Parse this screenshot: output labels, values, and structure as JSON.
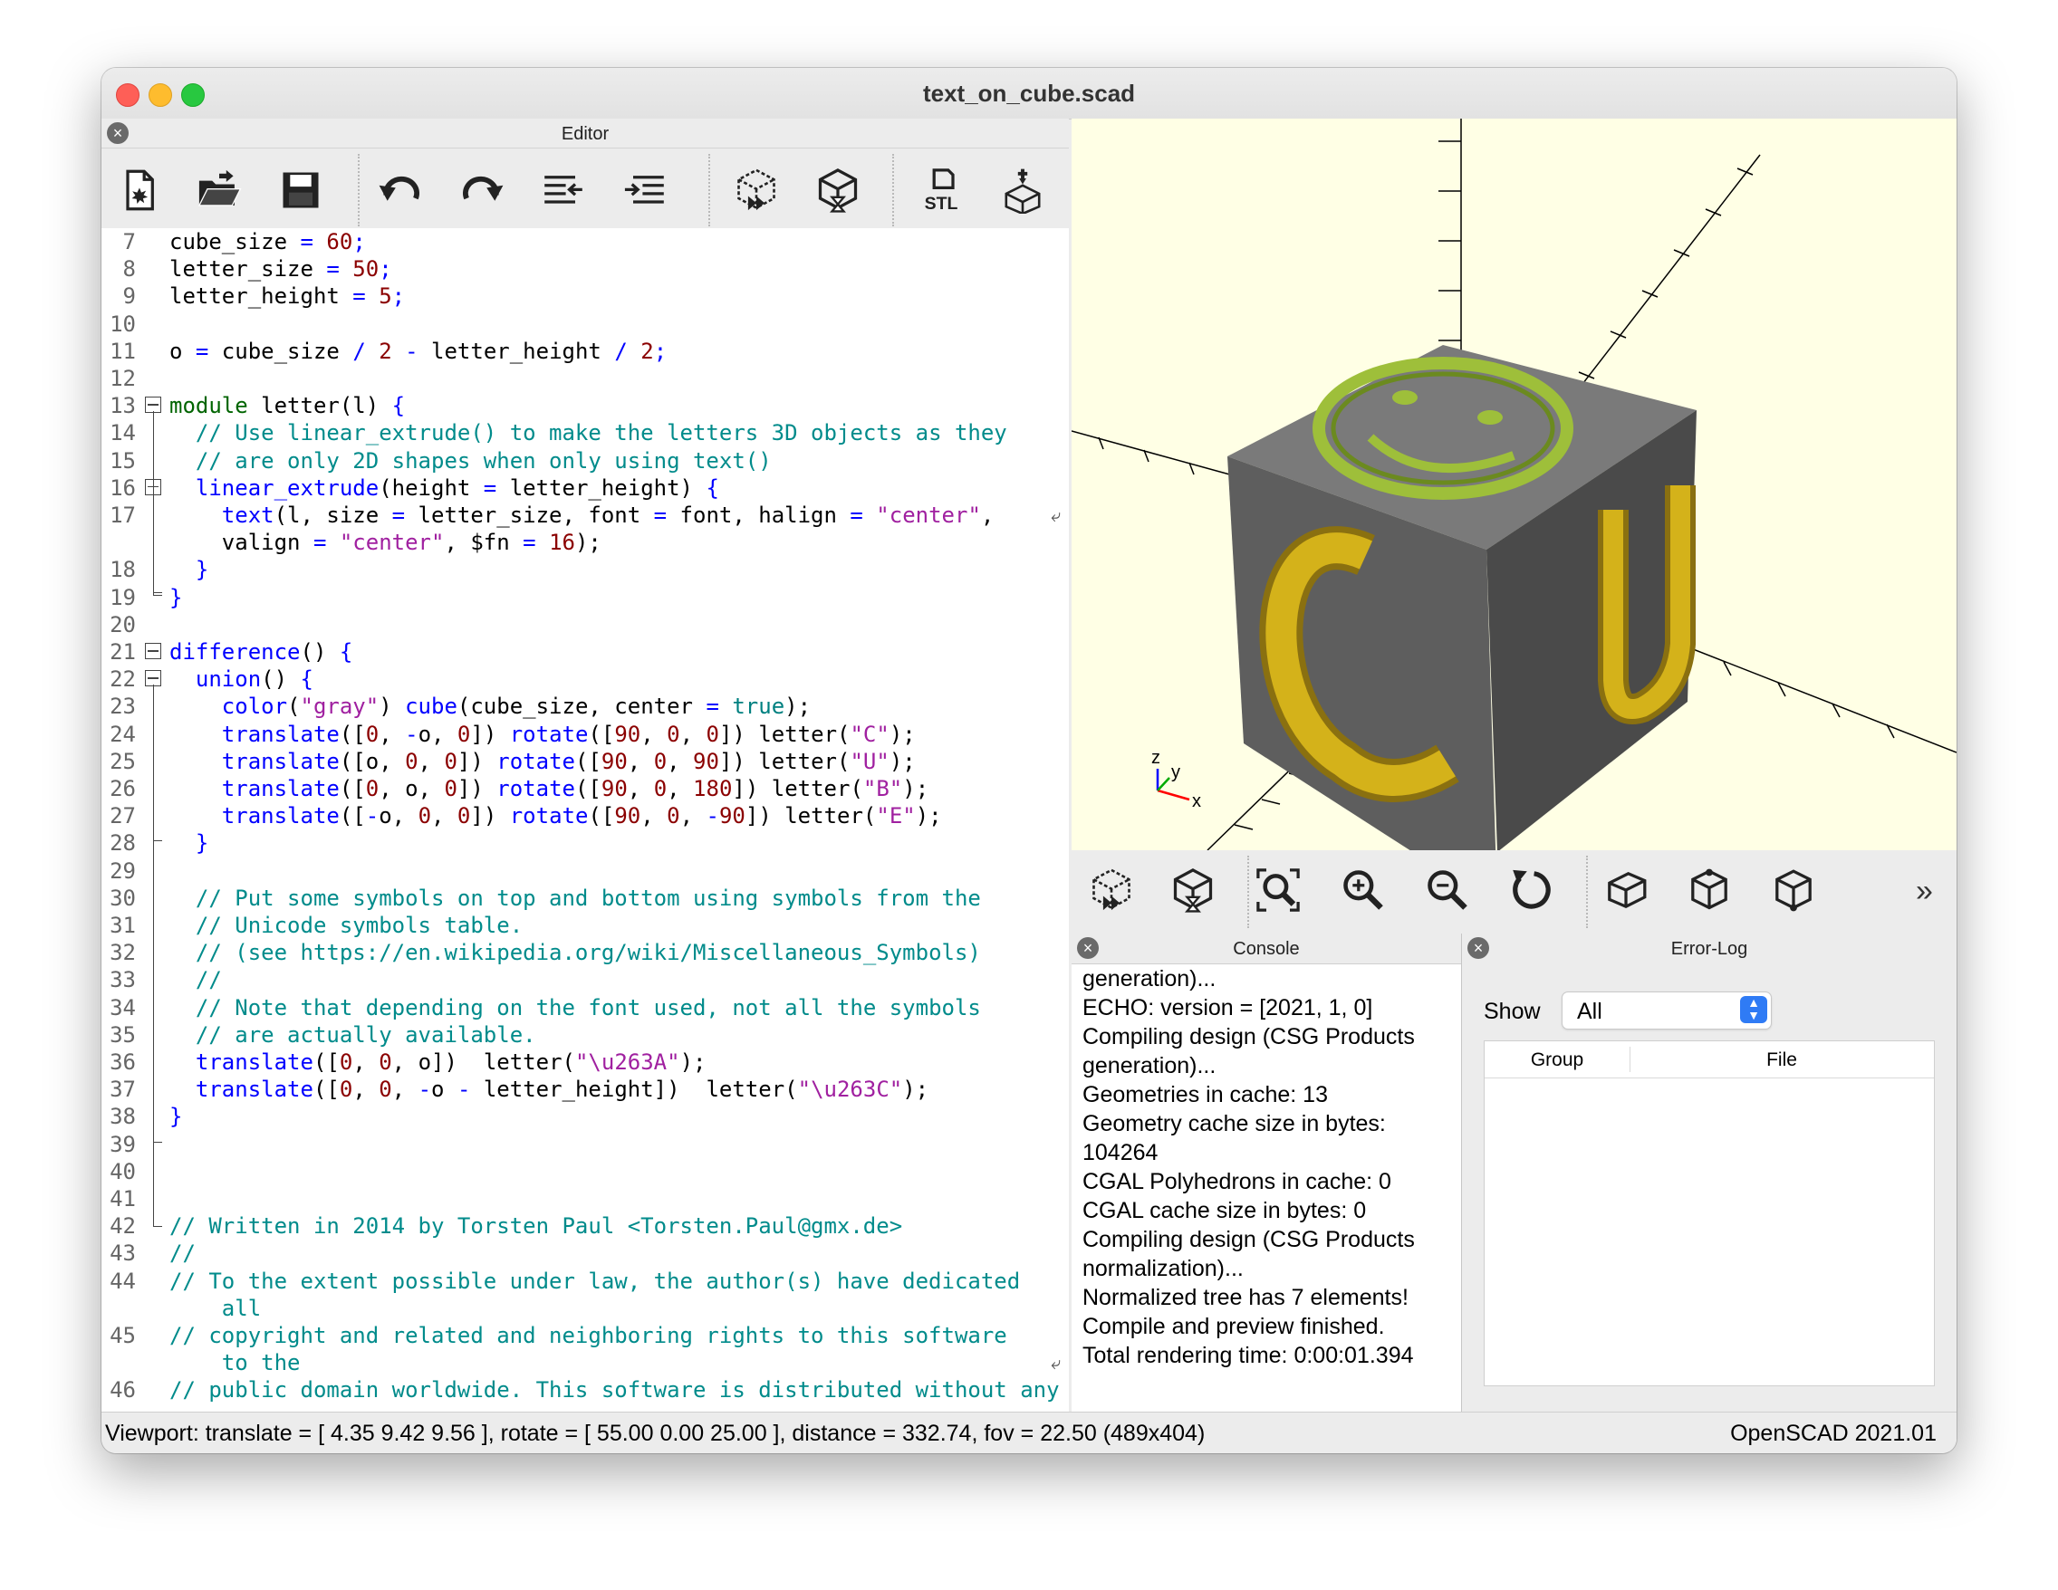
{
  "window": {
    "title": "text_on_cube.scad"
  },
  "editor": {
    "title": "Editor",
    "toolbar": [
      "new-file",
      "open-file",
      "save-file",
      "undo",
      "redo",
      "unindent",
      "indent",
      "preview",
      "render",
      "export-stl",
      "send-to-3d-print"
    ],
    "toolbar_stl_label": "STL",
    "lines": [
      {
        "n": "7",
        "t": [
          [
            "",
            "cube_size "
          ],
          [
            "o",
            "="
          ],
          [
            "",
            " "
          ],
          [
            "n",
            "60"
          ],
          [
            "o",
            ";"
          ]
        ]
      },
      {
        "n": "8",
        "t": [
          [
            "",
            "letter_size "
          ],
          [
            "o",
            "="
          ],
          [
            "",
            " "
          ],
          [
            "n",
            "50"
          ],
          [
            "o",
            ";"
          ]
        ]
      },
      {
        "n": "9",
        "t": [
          [
            "",
            "letter_height "
          ],
          [
            "o",
            "="
          ],
          [
            "",
            " "
          ],
          [
            "n",
            "5"
          ],
          [
            "o",
            ";"
          ]
        ]
      },
      {
        "n": "10",
        "t": []
      },
      {
        "n": "11",
        "t": [
          [
            "",
            "o "
          ],
          [
            "o",
            "="
          ],
          [
            "",
            " cube_size "
          ],
          [
            "o",
            "/"
          ],
          [
            "",
            " "
          ],
          [
            "n",
            "2"
          ],
          [
            "",
            " "
          ],
          [
            "o",
            "-"
          ],
          [
            "",
            " letter_height "
          ],
          [
            "o",
            "/"
          ],
          [
            "",
            " "
          ],
          [
            "n",
            "2"
          ],
          [
            "o",
            ";"
          ]
        ]
      },
      {
        "n": "12",
        "t": []
      },
      {
        "n": "13",
        "t": [
          [
            "m",
            "module"
          ],
          [
            "",
            " letter(l) "
          ],
          [
            "o",
            "{"
          ]
        ]
      },
      {
        "n": "14",
        "t": [
          [
            "",
            "  "
          ],
          [
            "c",
            "// Use linear_extrude() to make the letters 3D objects as they"
          ]
        ]
      },
      {
        "n": "15",
        "t": [
          [
            "",
            "  "
          ],
          [
            "c",
            "// are only 2D shapes when only using text()"
          ]
        ]
      },
      {
        "n": "16",
        "t": [
          [
            "",
            "  "
          ],
          [
            "k",
            "linear_extrude"
          ],
          [
            "",
            "(height "
          ],
          [
            "o",
            "="
          ],
          [
            "",
            " letter_height) "
          ],
          [
            "o",
            "{"
          ]
        ]
      },
      {
        "n": "17",
        "t": [
          [
            "",
            "    "
          ],
          [
            "k",
            "text"
          ],
          [
            "",
            "(l, size "
          ],
          [
            "o",
            "="
          ],
          [
            "",
            " letter_size, font "
          ],
          [
            "o",
            "="
          ],
          [
            "",
            " font, halign "
          ],
          [
            "o",
            "="
          ],
          [
            "",
            " "
          ],
          [
            "s",
            "\"center\""
          ],
          [
            "",
            ","
          ]
        ]
      },
      {
        "n": "",
        "t": [
          [
            "",
            "    valign "
          ],
          [
            "o",
            "="
          ],
          [
            "",
            " "
          ],
          [
            "s",
            "\"center\""
          ],
          [
            "",
            ", $fn "
          ],
          [
            "o",
            "="
          ],
          [
            "",
            " "
          ],
          [
            "n",
            "16"
          ],
          [
            "",
            ");"
          ]
        ]
      },
      {
        "n": "18",
        "t": [
          [
            "",
            "  "
          ],
          [
            "o",
            "}"
          ]
        ]
      },
      {
        "n": "19",
        "t": [
          [
            "o",
            "}"
          ]
        ]
      },
      {
        "n": "20",
        "t": []
      },
      {
        "n": "21",
        "t": [
          [
            "k",
            "difference"
          ],
          [
            "",
            "() "
          ],
          [
            "o",
            "{"
          ]
        ]
      },
      {
        "n": "22",
        "t": [
          [
            "",
            "  "
          ],
          [
            "k",
            "union"
          ],
          [
            "",
            "() "
          ],
          [
            "o",
            "{"
          ]
        ]
      },
      {
        "n": "23",
        "t": [
          [
            "",
            "    "
          ],
          [
            "k",
            "color"
          ],
          [
            "",
            "("
          ],
          [
            "s",
            "\"gray\""
          ],
          [
            "",
            ") "
          ],
          [
            "k",
            "cube"
          ],
          [
            "",
            "(cube_size, center "
          ],
          [
            "o",
            "="
          ],
          [
            "",
            " "
          ],
          [
            "b",
            "true"
          ],
          [
            "",
            ");"
          ]
        ]
      },
      {
        "n": "24",
        "t": [
          [
            "",
            "    "
          ],
          [
            "k",
            "translate"
          ],
          [
            "",
            "(["
          ],
          [
            "n",
            "0"
          ],
          [
            "",
            ", "
          ],
          [
            "o",
            "-"
          ],
          [
            "",
            "o, "
          ],
          [
            "n",
            "0"
          ],
          [
            "",
            "]) "
          ],
          [
            "k",
            "rotate"
          ],
          [
            "",
            "(["
          ],
          [
            "n",
            "90"
          ],
          [
            "",
            ", "
          ],
          [
            "n",
            "0"
          ],
          [
            "",
            ", "
          ],
          [
            "n",
            "0"
          ],
          [
            "",
            "]) letter("
          ],
          [
            "s",
            "\"C\""
          ],
          [
            "",
            ");"
          ]
        ]
      },
      {
        "n": "25",
        "t": [
          [
            "",
            "    "
          ],
          [
            "k",
            "translate"
          ],
          [
            "",
            "([o, "
          ],
          [
            "n",
            "0"
          ],
          [
            "",
            ", "
          ],
          [
            "n",
            "0"
          ],
          [
            "",
            "]) "
          ],
          [
            "k",
            "rotate"
          ],
          [
            "",
            "(["
          ],
          [
            "n",
            "90"
          ],
          [
            "",
            ", "
          ],
          [
            "n",
            "0"
          ],
          [
            "",
            ", "
          ],
          [
            "n",
            "90"
          ],
          [
            "",
            "]) letter("
          ],
          [
            "s",
            "\"U\""
          ],
          [
            "",
            ");"
          ]
        ]
      },
      {
        "n": "26",
        "t": [
          [
            "",
            "    "
          ],
          [
            "k",
            "translate"
          ],
          [
            "",
            "(["
          ],
          [
            "n",
            "0"
          ],
          [
            "",
            ", o, "
          ],
          [
            "n",
            "0"
          ],
          [
            "",
            "]) "
          ],
          [
            "k",
            "rotate"
          ],
          [
            "",
            "(["
          ],
          [
            "n",
            "90"
          ],
          [
            "",
            ", "
          ],
          [
            "n",
            "0"
          ],
          [
            "",
            ", "
          ],
          [
            "n",
            "180"
          ],
          [
            "",
            "]) letter("
          ],
          [
            "s",
            "\"B\""
          ],
          [
            "",
            ");"
          ]
        ]
      },
      {
        "n": "27",
        "t": [
          [
            "",
            "    "
          ],
          [
            "k",
            "translate"
          ],
          [
            "",
            "(["
          ],
          [
            "o",
            "-"
          ],
          [
            "",
            "o, "
          ],
          [
            "n",
            "0"
          ],
          [
            "",
            ", "
          ],
          [
            "n",
            "0"
          ],
          [
            "",
            "]) "
          ],
          [
            "k",
            "rotate"
          ],
          [
            "",
            "(["
          ],
          [
            "n",
            "90"
          ],
          [
            "",
            ", "
          ],
          [
            "n",
            "0"
          ],
          [
            "",
            ", "
          ],
          [
            "o",
            "-"
          ],
          [
            "n",
            "90"
          ],
          [
            "",
            "]) letter("
          ],
          [
            "s",
            "\"E\""
          ],
          [
            "",
            ");"
          ]
        ]
      },
      {
        "n": "28",
        "t": [
          [
            "",
            "  "
          ],
          [
            "o",
            "}"
          ]
        ]
      },
      {
        "n": "29",
        "t": []
      },
      {
        "n": "30",
        "t": [
          [
            "",
            "  "
          ],
          [
            "c",
            "// Put some symbols on top and bottom using symbols from the"
          ]
        ]
      },
      {
        "n": "31",
        "t": [
          [
            "",
            "  "
          ],
          [
            "c",
            "// Unicode symbols table."
          ]
        ]
      },
      {
        "n": "32",
        "t": [
          [
            "",
            "  "
          ],
          [
            "c",
            "// (see https://en.wikipedia.org/wiki/Miscellaneous_Symbols)"
          ]
        ]
      },
      {
        "n": "33",
        "t": [
          [
            "",
            "  "
          ],
          [
            "c",
            "//"
          ]
        ]
      },
      {
        "n": "34",
        "t": [
          [
            "",
            "  "
          ],
          [
            "c",
            "// Note that depending on the font used, not all the symbols"
          ]
        ]
      },
      {
        "n": "35",
        "t": [
          [
            "",
            "  "
          ],
          [
            "c",
            "// are actually available."
          ]
        ]
      },
      {
        "n": "36",
        "t": [
          [
            "",
            "  "
          ],
          [
            "k",
            "translate"
          ],
          [
            "",
            "(["
          ],
          [
            "n",
            "0"
          ],
          [
            "",
            ", "
          ],
          [
            "n",
            "0"
          ],
          [
            "",
            ", o])  letter("
          ],
          [
            "s",
            "\"\\u263A\""
          ],
          [
            "",
            ");"
          ]
        ]
      },
      {
        "n": "37",
        "t": [
          [
            "",
            "  "
          ],
          [
            "k",
            "translate"
          ],
          [
            "",
            "(["
          ],
          [
            "n",
            "0"
          ],
          [
            "",
            ", "
          ],
          [
            "n",
            "0"
          ],
          [
            "",
            ", "
          ],
          [
            "o",
            "-"
          ],
          [
            "",
            "o "
          ],
          [
            "o",
            "-"
          ],
          [
            "",
            " letter_height])  letter("
          ],
          [
            "s",
            "\"\\u263C\""
          ],
          [
            "",
            ");"
          ]
        ]
      },
      {
        "n": "38",
        "t": [
          [
            "o",
            "}"
          ]
        ]
      },
      {
        "n": "39",
        "t": []
      },
      {
        "n": "40",
        "t": []
      },
      {
        "n": "41",
        "t": []
      },
      {
        "n": "42",
        "t": [
          [
            "c",
            "// Written in 2014 by Torsten Paul <Torsten.Paul@gmx.de>"
          ]
        ]
      },
      {
        "n": "43",
        "t": [
          [
            "c",
            "//"
          ]
        ]
      },
      {
        "n": "44",
        "t": [
          [
            "c",
            "// To the extent possible under law, the author(s) have dedicated"
          ]
        ]
      },
      {
        "n": "",
        "t": [
          [
            "c",
            "    all"
          ]
        ]
      },
      {
        "n": "45",
        "t": [
          [
            "c",
            "// copyright and related and neighboring rights to this software"
          ]
        ]
      },
      {
        "n": "",
        "t": [
          [
            "c",
            "    to the"
          ]
        ]
      },
      {
        "n": "46",
        "t": [
          [
            "c",
            "// public domain worldwide. This software is distributed without any"
          ]
        ]
      }
    ]
  },
  "viewport": {
    "axis_labels": {
      "x": "x",
      "y": "y",
      "z": "z"
    },
    "toolbar": [
      "preview",
      "render",
      "view-all",
      "zoom-in",
      "zoom-out",
      "reset-view",
      "view-perspective",
      "view-orthogonal",
      "view-diagonal"
    ],
    "more": "»"
  },
  "console": {
    "title": "Console",
    "lines": [
      "generation)...",
      "ECHO: version = [2021, 1, 0]",
      "Compiling design (CSG Products",
      "generation)...",
      "Geometries in cache: 13",
      "Geometry cache size in bytes:",
      "104264",
      "CGAL Polyhedrons in cache: 0",
      "CGAL cache size in bytes: 0",
      "Compiling design (CSG Products",
      "normalization)...",
      "Normalized tree has 7 elements!",
      "Compile and preview finished.",
      "Total rendering time: 0:00:01.394"
    ]
  },
  "errorlog": {
    "title": "Error-Log",
    "show_label": "Show",
    "show_value": "All",
    "columns": [
      "Group",
      "File"
    ]
  },
  "status": {
    "left": "Viewport: translate = [ 4.35 9.42 9.56 ], rotate = [ 55.00 0.00 25.00 ], distance = 332.74, fov = 22.50 (489x404)",
    "right": "OpenSCAD 2021.01"
  },
  "colors": {
    "cube_gray": "#6e6e6e",
    "letter_yellow": "#d4b21a",
    "viewport_bg": "#ffffe5",
    "keyword": "#0000ff",
    "number": "#8b0000",
    "string": "#a020a0",
    "comment": "#008b8b"
  }
}
